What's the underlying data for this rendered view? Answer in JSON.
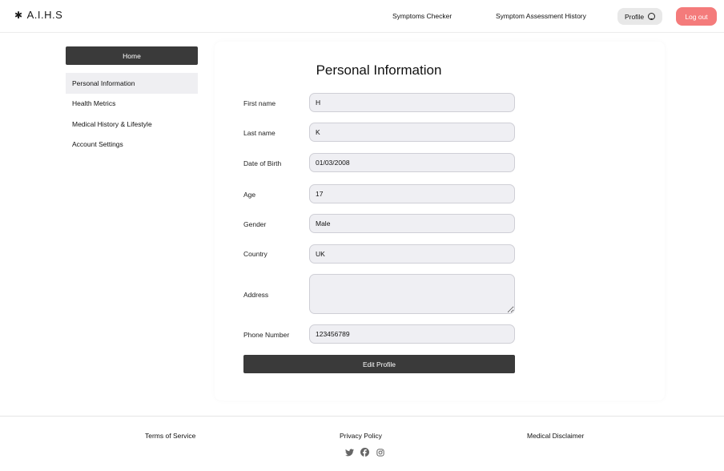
{
  "header": {
    "logo_mark": "✱",
    "logo_text": "A.I.H.S",
    "nav": {
      "symptoms_checker": "Symptoms Checker",
      "assessment_history": "Symptom Assessment History"
    },
    "profile_label": "Profile",
    "logout_label": "Log out"
  },
  "sidebar": {
    "home_label": "Home",
    "items": [
      {
        "label": "Personal Information",
        "active": true
      },
      {
        "label": "Health Metrics",
        "active": false
      },
      {
        "label": "Medical History & Lifestyle",
        "active": false
      },
      {
        "label": "Account Settings",
        "active": false
      }
    ]
  },
  "form": {
    "title": "Personal Information",
    "fields": {
      "first_name": {
        "label": "First name",
        "value": "H"
      },
      "last_name": {
        "label": "Last name",
        "value": "K"
      },
      "dob": {
        "label": "Date of Birth",
        "value": "01/03/2008"
      },
      "age": {
        "label": "Age",
        "value": "17"
      },
      "gender": {
        "label": "Gender",
        "value": "Male"
      },
      "country": {
        "label": "Country",
        "value": "UK"
      },
      "address": {
        "label": "Address",
        "value": ""
      },
      "phone": {
        "label": "Phone Number",
        "value": "123456789"
      }
    },
    "edit_button": "Edit Profile"
  },
  "footer": {
    "terms": "Terms of Service",
    "privacy": "Privacy Policy",
    "disclaimer": "Medical Disclaimer",
    "social_icons": [
      "twitter-icon",
      "facebook-icon",
      "instagram-icon"
    ]
  },
  "colors": {
    "accent_dark": "#3a3a3a",
    "logout_red": "#f47b7b",
    "input_bg": "#efeff3",
    "active_item_bg": "#efeff2"
  }
}
